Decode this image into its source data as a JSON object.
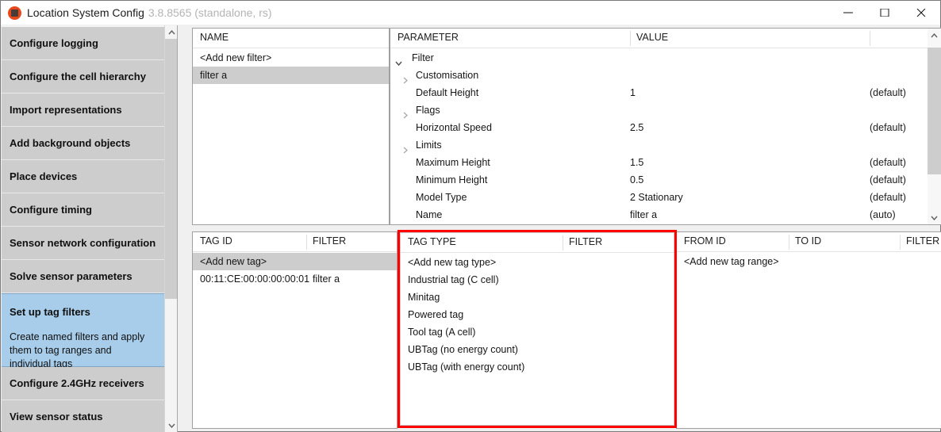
{
  "window": {
    "title": "Location System Config",
    "version": "3.8.8565 (standalone, rs)",
    "icon": "app-logo-icon",
    "controls": {
      "minimize": "minimize-icon",
      "maximize": "maximize-icon",
      "close": "close-icon"
    }
  },
  "sidebar": {
    "items": [
      {
        "title": "Configure logging",
        "desc": "",
        "selected": false
      },
      {
        "title": "Configure the cell hierarchy",
        "desc": "",
        "selected": false
      },
      {
        "title": "Import representations",
        "desc": "",
        "selected": false
      },
      {
        "title": "Add background objects",
        "desc": "",
        "selected": false
      },
      {
        "title": "Place devices",
        "desc": "",
        "selected": false
      },
      {
        "title": "Configure timing",
        "desc": "",
        "selected": false
      },
      {
        "title": "Sensor network configuration",
        "desc": "",
        "selected": false
      },
      {
        "title": "Solve sensor parameters",
        "desc": "",
        "selected": false
      },
      {
        "title": "Set up tag filters",
        "desc": "Create named filters and apply them to tag ranges and individual tags",
        "selected": true
      },
      {
        "title": "Configure 2.4GHz receivers",
        "desc": "",
        "selected": false
      },
      {
        "title": "View sensor status",
        "desc": "",
        "selected": false
      }
    ]
  },
  "filters_panel": {
    "columns": [
      "NAME"
    ],
    "rows": [
      {
        "name": "<Add new filter>",
        "selected": false
      },
      {
        "name": "filter a",
        "selected": true
      }
    ]
  },
  "parameters_panel": {
    "columns": [
      "PARAMETER",
      "VALUE"
    ],
    "rows": [
      {
        "label": "Filter",
        "value": "",
        "note": "",
        "indent": 0,
        "expander": "expanded"
      },
      {
        "label": "Customisation",
        "value": "",
        "note": "",
        "indent": 1,
        "expander": "collapsed"
      },
      {
        "label": "Default Height",
        "value": "1",
        "note": "(default)",
        "indent": 1,
        "expander": "none"
      },
      {
        "label": "Flags",
        "value": "",
        "note": "",
        "indent": 1,
        "expander": "collapsed"
      },
      {
        "label": "Horizontal Speed",
        "value": "2.5",
        "note": "(default)",
        "indent": 1,
        "expander": "none"
      },
      {
        "label": "Limits",
        "value": "",
        "note": "",
        "indent": 1,
        "expander": "collapsed"
      },
      {
        "label": "Maximum Height",
        "value": "1.5",
        "note": "(default)",
        "indent": 1,
        "expander": "none"
      },
      {
        "label": "Minimum Height",
        "value": "0.5",
        "note": "(default)",
        "indent": 1,
        "expander": "none"
      },
      {
        "label": "Model Type",
        "value": "2 Stationary",
        "note": "(default)",
        "indent": 1,
        "expander": "none"
      },
      {
        "label": "Name",
        "value": "filter a",
        "note": "(auto)",
        "indent": 1,
        "expander": "none"
      }
    ]
  },
  "tags_panel": {
    "columns": [
      "TAG ID",
      "FILTER"
    ],
    "rows": [
      {
        "tag_id": "<Add new tag>",
        "filter": "",
        "selected": true
      },
      {
        "tag_id": "00:11:CE:00:00:00:00:01",
        "filter": "filter a",
        "selected": false
      }
    ]
  },
  "tag_types_panel": {
    "columns": [
      "TAG TYPE",
      "FILTER"
    ],
    "highlight_color": "#ff0000",
    "rows": [
      {
        "tag_type": "<Add new tag type>",
        "filter": ""
      },
      {
        "tag_type": "Industrial tag (C cell)",
        "filter": ""
      },
      {
        "tag_type": "Minitag",
        "filter": ""
      },
      {
        "tag_type": "Powered tag",
        "filter": ""
      },
      {
        "tag_type": "Tool tag (A cell)",
        "filter": ""
      },
      {
        "tag_type": "UBTag (no energy count)",
        "filter": ""
      },
      {
        "tag_type": "UBTag (with energy count)",
        "filter": ""
      }
    ]
  },
  "tag_ranges_panel": {
    "columns": [
      "FROM ID",
      "TO ID",
      "FILTER"
    ],
    "rows": [
      {
        "from_id": "<Add new tag range>",
        "to_id": "",
        "filter": ""
      }
    ]
  }
}
